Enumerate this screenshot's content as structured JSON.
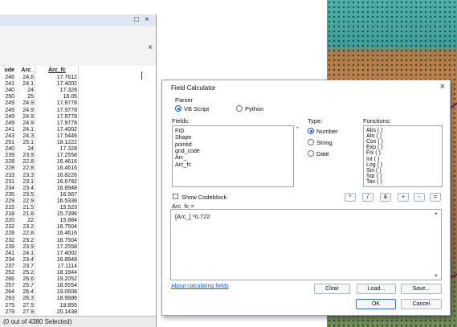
{
  "table_panel": {
    "titlebar_buttons": [
      "□",
      "×"
    ],
    "toolbar_close": "×",
    "columns": [
      "ode",
      "Arc_",
      "Arc_fc"
    ],
    "rows": [
      [
        "246",
        "24.6",
        "17.7612"
      ],
      [
        "241",
        "24.1",
        "17.4002"
      ],
      [
        "240",
        "24",
        "17.328"
      ],
      [
        "250",
        "25",
        "18.05"
      ],
      [
        "249",
        "24.9",
        "17.9778"
      ],
      [
        "249",
        "24.9",
        "17.9778"
      ],
      [
        "249",
        "24.9",
        "17.9778"
      ],
      [
        "249",
        "24.9",
        "17.9778"
      ],
      [
        "241",
        "24.1",
        "17.4002"
      ],
      [
        "243",
        "24.3",
        "17.5446"
      ],
      [
        "251",
        "25.1",
        "18.1222"
      ],
      [
        "240",
        "24",
        "17.328"
      ],
      [
        "239",
        "23.9",
        "17.2558"
      ],
      [
        "228",
        "22.8",
        "16.4616"
      ],
      [
        "228",
        "22.8",
        "16.4616"
      ],
      [
        "233",
        "23.3",
        "16.8226"
      ],
      [
        "231",
        "23.1",
        "16.6782"
      ],
      [
        "234",
        "23.4",
        "16.8948"
      ],
      [
        "235",
        "23.5",
        "16.967"
      ],
      [
        "229",
        "22.9",
        "16.5338"
      ],
      [
        "215",
        "21.5",
        "15.523"
      ],
      [
        "218",
        "21.8",
        "15.7396"
      ],
      [
        "220",
        "22",
        "15.884"
      ],
      [
        "232",
        "23.2",
        "16.7504"
      ],
      [
        "228",
        "22.8",
        "16.4616"
      ],
      [
        "232",
        "23.2",
        "16.7504"
      ],
      [
        "239",
        "23.9",
        "17.2558"
      ],
      [
        "241",
        "24.1",
        "17.4002"
      ],
      [
        "234",
        "23.4",
        "16.8948"
      ],
      [
        "237",
        "23.7",
        "17.1114"
      ],
      [
        "252",
        "25.2",
        "18.1944"
      ],
      [
        "266",
        "26.6",
        "19.2052"
      ],
      [
        "257",
        "25.7",
        "18.5554"
      ],
      [
        "264",
        "26.4",
        "19.0608"
      ],
      [
        "263",
        "26.3",
        "18.9886"
      ],
      [
        "275",
        "27.5",
        "19.855"
      ],
      [
        "279",
        "27.9",
        "20.1438"
      ],
      [
        "278",
        "27.8",
        "20.0716"
      ]
    ],
    "status": "(0 out of 4380 Selected)"
  },
  "dialog": {
    "title": "Field Calculator",
    "close": "×",
    "parser_label": "Parser",
    "parser_options": [
      "VB Script",
      "Python"
    ],
    "fields_label": "Fields:",
    "fields": [
      "FID",
      "Shape",
      "pointid",
      "grid_code",
      "Arc_",
      "Arc_fc"
    ],
    "type_label": "Type:",
    "types": [
      "Number",
      "String",
      "Date"
    ],
    "functions_label": "Functions:",
    "functions": [
      "Abs ( )",
      "Atn ( )",
      "Cos ( )",
      "Exp ( )",
      "Fix ( )",
      "Int ( )",
      "Log ( )",
      "Sin ( )",
      "Sqr ( )",
      "Tan ( )"
    ],
    "show_codeblock": "Show Codeblock",
    "operators": [
      "*",
      "/",
      "&",
      "+",
      "-",
      "="
    ],
    "target_label": "Arc_fc =",
    "expression": "[Arc_] *0.722",
    "about_link": "About calculating fields",
    "clear": "Clear",
    "load": "Load...",
    "save": "Save...",
    "ok": "OK",
    "cancel": "Cancel"
  }
}
